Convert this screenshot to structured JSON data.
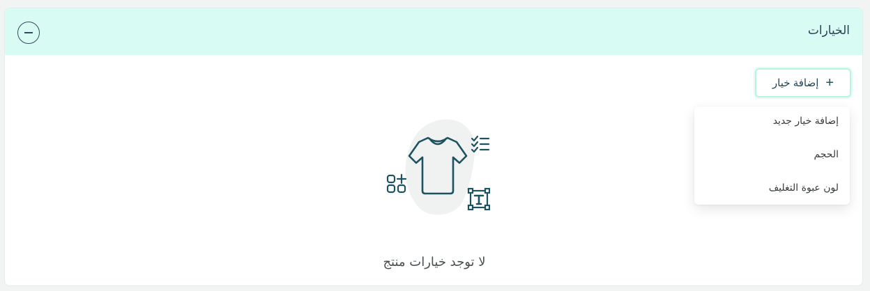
{
  "panel": {
    "title": "الخيارات",
    "collapse_icon": "minus-circle-icon"
  },
  "toolbar": {
    "add_option_label": "إضافة خيار",
    "add_icon": "plus-icon"
  },
  "dropdown": {
    "items": [
      {
        "label": "إضافة خيار جديد"
      },
      {
        "label": "الحجم"
      },
      {
        "label": "لون عبوة التغليف"
      }
    ]
  },
  "empty_state": {
    "message": "لا توجد خيارات منتج",
    "illustration_icons": [
      "tshirt-icon",
      "checklist-icon",
      "add-apps-icon",
      "text-frame-icon"
    ]
  },
  "colors": {
    "header_bg": "#d8fcf4",
    "accent_border": "#b8f3e4",
    "icon_color": "#1d5260"
  }
}
